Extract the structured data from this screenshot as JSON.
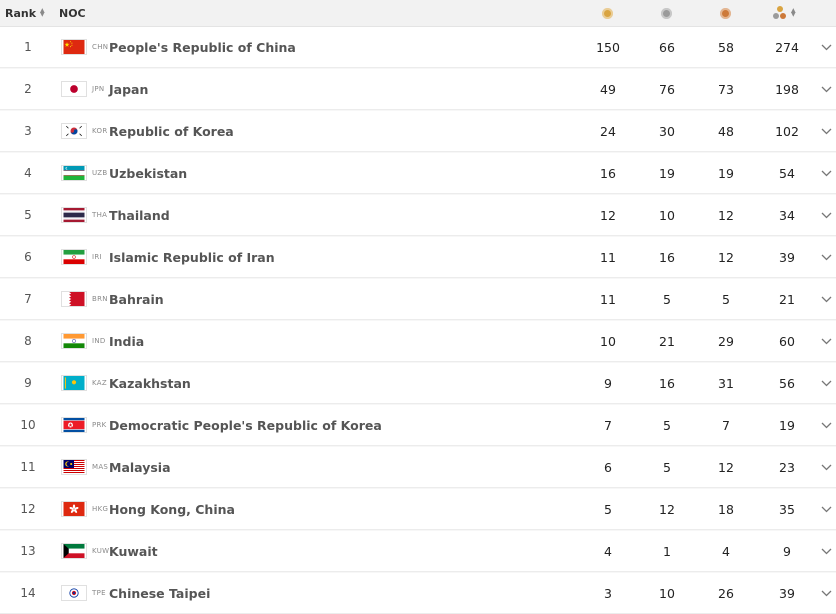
{
  "header": {
    "rank_label": "Rank",
    "noc_label": "NOC",
    "medal_colors": {
      "gold": "#d9a441",
      "silver": "#9b9b9b",
      "bronze": "#cd7a3a"
    }
  },
  "rows": [
    {
      "rank": "1",
      "code": "CHN",
      "name": "People's Republic of China",
      "gold": "150",
      "silver": "66",
      "bronze": "58",
      "total": "274"
    },
    {
      "rank": "2",
      "code": "JPN",
      "name": "Japan",
      "gold": "49",
      "silver": "76",
      "bronze": "73",
      "total": "198"
    },
    {
      "rank": "3",
      "code": "KOR",
      "name": "Republic of Korea",
      "gold": "24",
      "silver": "30",
      "bronze": "48",
      "total": "102"
    },
    {
      "rank": "4",
      "code": "UZB",
      "name": "Uzbekistan",
      "gold": "16",
      "silver": "19",
      "bronze": "19",
      "total": "54"
    },
    {
      "rank": "5",
      "code": "THA",
      "name": "Thailand",
      "gold": "12",
      "silver": "10",
      "bronze": "12",
      "total": "34"
    },
    {
      "rank": "6",
      "code": "IRI",
      "name": "Islamic Republic of Iran",
      "gold": "11",
      "silver": "16",
      "bronze": "12",
      "total": "39"
    },
    {
      "rank": "7",
      "code": "BRN",
      "name": "Bahrain",
      "gold": "11",
      "silver": "5",
      "bronze": "5",
      "total": "21"
    },
    {
      "rank": "8",
      "code": "IND",
      "name": "India",
      "gold": "10",
      "silver": "21",
      "bronze": "29",
      "total": "60"
    },
    {
      "rank": "9",
      "code": "KAZ",
      "name": "Kazakhstan",
      "gold": "9",
      "silver": "16",
      "bronze": "31",
      "total": "56"
    },
    {
      "rank": "10",
      "code": "PRK",
      "name": "Democratic People's Republic of Korea",
      "gold": "7",
      "silver": "5",
      "bronze": "7",
      "total": "19"
    },
    {
      "rank": "11",
      "code": "MAS",
      "name": "Malaysia",
      "gold": "6",
      "silver": "5",
      "bronze": "12",
      "total": "23"
    },
    {
      "rank": "12",
      "code": "HKG",
      "name": "Hong Kong, China",
      "gold": "5",
      "silver": "12",
      "bronze": "18",
      "total": "35"
    },
    {
      "rank": "13",
      "code": "KUW",
      "name": "Kuwait",
      "gold": "4",
      "silver": "1",
      "bronze": "4",
      "total": "9"
    },
    {
      "rank": "14",
      "code": "TPE",
      "name": "Chinese Taipei",
      "gold": "3",
      "silver": "10",
      "bronze": "26",
      "total": "39"
    }
  ]
}
